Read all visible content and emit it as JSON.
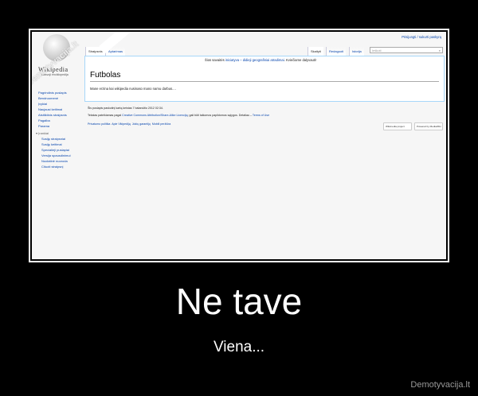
{
  "wiki": {
    "logo_wordmark": "Wikipedia",
    "logo_tagline": "Laisvoji enciklopedija",
    "personal_link": "Prisijungti / sukurti paskyrą",
    "tabs_left": [
      "Straipsnis",
      "Aptarimas"
    ],
    "tabs_right": [
      "Skaityti",
      "Redaguoti",
      "Istorija"
    ],
    "search_placeholder": "Ieškoti",
    "sidebar": [
      "Pagrindinis puslapis",
      "Bendruomenė",
      "Įvykiai",
      "Naujausi keitimai",
      "Atsitiktinis straipsnis",
      "Pagalba",
      "Parama"
    ],
    "tools_heading": "Įrankiai",
    "tools": [
      "Susiję straipsniai",
      "Susiję keitimai",
      "Specialieji puslapiai",
      "Versija spausdinimui",
      "Nuolatinė nuoroda",
      "Cituoti straipsnį"
    ],
    "notice_prefix": "Šios savaitės",
    "notice_link": "iniciatyva – didieji geografiniai atradimai",
    "notice_suffix": ". Kviečiame dalyvauti!",
    "page_title": "Futbolas",
    "body_text": "Mane erzina kai wikipedia nusinaso mano namu darbus....",
    "footer_modified": "Šis puslapis paskutinį kartą keistas 7 balandžio 2012 02:34.",
    "footer_license_prefix": "Tekstas pateikiamas pagal",
    "footer_license_link": "Creative Commons Attribution/Share-Alike Licenciją",
    "footer_license_suffix": "; gali būti taikomos papildomos sąlygos. Detaliau –",
    "footer_terms": "Terms of Use",
    "footer_links": [
      "Privatumo politika",
      "Apie Vikipediją",
      "Jokių garantijų",
      "Mobili peržiūra"
    ],
    "badge_wikimedia": "Wikimedia project",
    "badge_mediawiki": "Powered by MediaWiki"
  },
  "watermark": "Demotyvacija.lt",
  "poster": {
    "title": "Ne tave",
    "subtitle": "Viena...",
    "site": "Demotyvacija.lt"
  }
}
